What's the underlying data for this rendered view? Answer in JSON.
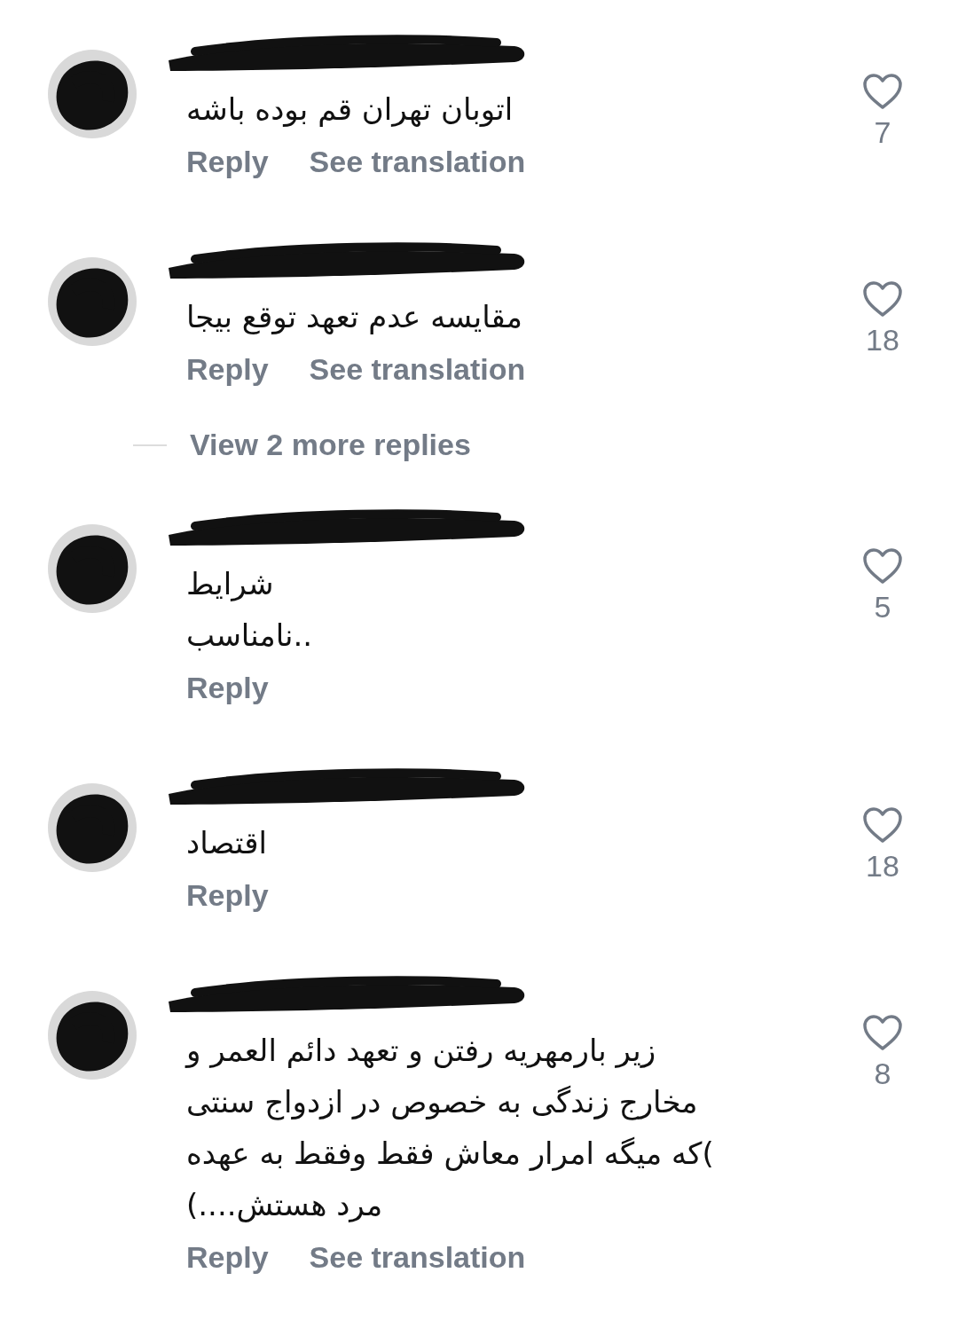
{
  "items": [
    {
      "kind": "comment",
      "text_lines": [
        "اتوبان تهران قم بوده باشه"
      ],
      "reply": "Reply",
      "translation": "See translation",
      "likes": "7"
    },
    {
      "kind": "comment",
      "text_lines": [
        "مقایسه عدم تعهد توقع بیجا"
      ],
      "reply": "Reply",
      "translation": "See translation",
      "likes": "18"
    },
    {
      "kind": "view_replies",
      "label": "View 2 more replies"
    },
    {
      "kind": "comment",
      "text_lines": [
        "شرایط",
        "..نامناسب"
      ],
      "reply": "Reply",
      "likes": "5"
    },
    {
      "kind": "comment",
      "text_lines": [
        "اقتصاد"
      ],
      "reply": "Reply",
      "likes": "18"
    },
    {
      "kind": "comment",
      "text_lines": [
        "زیر بارمهریه رفتن و تعهد دائم العمر و",
        "مخارج زندگی به خصوص در ازدواج سنتی",
        ")که میگه امرار معاش فقط وفقط به عهده",
        "مرد هستش....)"
      ],
      "reply": "Reply",
      "translation": "See translation",
      "likes": "8"
    }
  ]
}
